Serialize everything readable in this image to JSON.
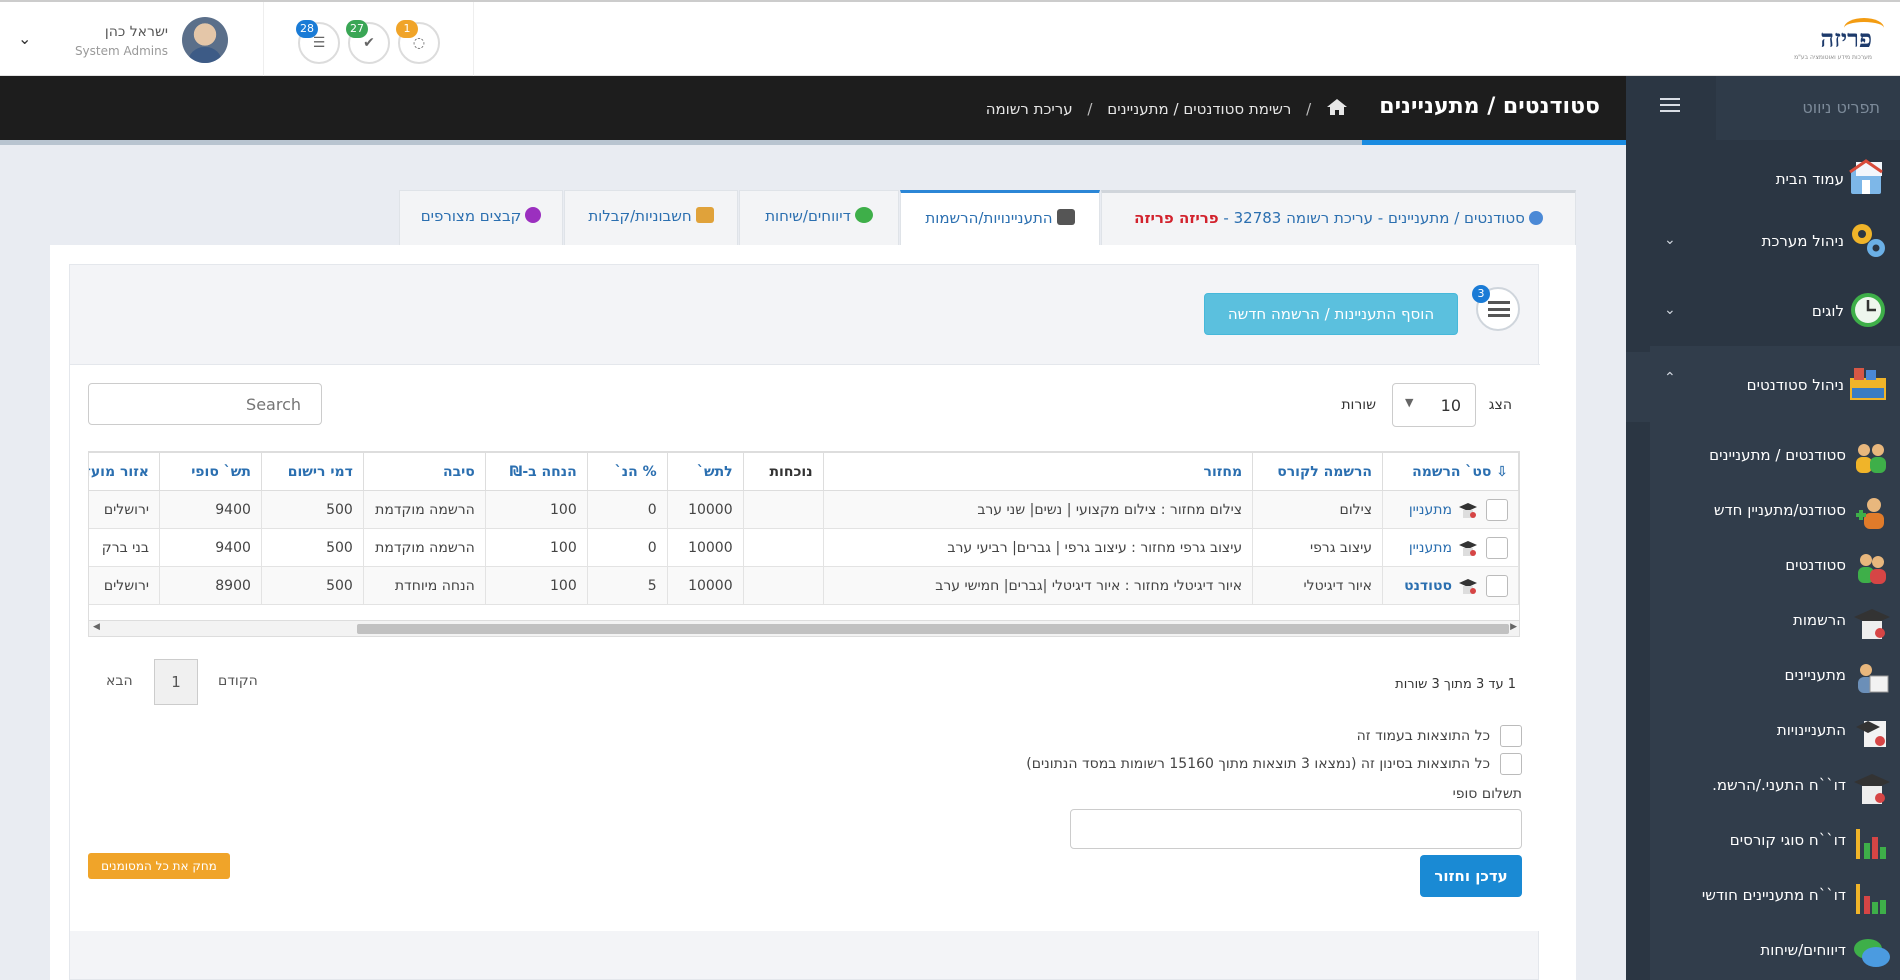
{
  "header": {
    "logo_text": "פריזה",
    "logo_tagline": "מערכות מידע ואוטומציה בע\"מ",
    "user": {
      "name": "ישראל כהן",
      "role": "System Admins"
    },
    "notifications": [
      {
        "count": "28",
        "icon": "tasks-icon",
        "color": "#1a7bd6"
      },
      {
        "count": "27",
        "icon": "check-icon",
        "color": "#3aa655"
      },
      {
        "count": "1",
        "icon": "spinner-icon",
        "color": "#f0a429"
      }
    ]
  },
  "sidebar": {
    "search_placeholder": "תפריט ניווט",
    "items": [
      {
        "label": "עמוד הבית",
        "icon": "home-page-icon"
      },
      {
        "label": "ניהול מערכת",
        "icon": "gears-icon"
      },
      {
        "label": "לוגים",
        "icon": "clock-icon"
      },
      {
        "label": "ניהול סטודנטים",
        "icon": "students-folder-icon"
      }
    ],
    "sub_items": [
      {
        "label": "סטודנטים / מתעניינים",
        "icon": "people-icon"
      },
      {
        "label": "סטודנט/מתעניין חדש",
        "icon": "add-person-icon"
      },
      {
        "label": "סטודנטים",
        "icon": "students-icon"
      },
      {
        "label": "הרשמות",
        "icon": "graduation-cap-icon"
      },
      {
        "label": "מתעניינים",
        "icon": "contact-card-icon"
      },
      {
        "label": "התעניינויות",
        "icon": "diploma-icon"
      },
      {
        "label": "דו``ח התעני./הרשמ.",
        "icon": "report-cap-icon"
      },
      {
        "label": "דו``ח סוגי קורסים",
        "icon": "bar-chart-icon"
      },
      {
        "label": "דו``ח מתעניינים חודשי",
        "icon": "bar-chart-people-icon"
      },
      {
        "label": "דיווחים/שיחות",
        "icon": "chat-icon"
      }
    ]
  },
  "pagebar": {
    "title": "סטודנטים / מתעניינים",
    "breadcrumbs": [
      "רשימת סטודנטים / מתעניינים",
      "עריכת רשומה"
    ]
  },
  "tabs": {
    "main_prefix": "סטודנטים / מתעניינים - עריכת רשומה 32783 - ",
    "main_name": "פריזה פריזה",
    "interests": "התעניינויות/הרשמות",
    "reports": "דיווחים/שיחות",
    "invoices": "חשבוניות/קבלות",
    "files": "קבצים מצורפים"
  },
  "toolbar": {
    "list_badge": "3",
    "add_button": "הוסף התעניינות / הרשמה חדשה"
  },
  "table": {
    "length_label": "הצג",
    "length_value": "10",
    "length_suffix": "שורות",
    "search_placeholder": "Search",
    "columns": [
      "סט` הרשמה",
      "הרשמה לקורס",
      "מחזור",
      "נוכחות",
      "לתש`",
      "% הנ`",
      "הנחה ב-₪",
      "סיבה",
      "דמי רישום",
      "תש` סופי",
      "אזור מועדן"
    ],
    "rows": [
      {
        "status": "מתעניין",
        "course": "צילום",
        "cycle": "צילום מחזור : צילום מקצועי | נשים| שני ערב",
        "attendance": "",
        "to_pay": "10000",
        "pct": "0",
        "discount": "100",
        "reason": "הרשמה מוקדמת",
        "reg_fee": "500",
        "final": "9400",
        "area": "ירושלים"
      },
      {
        "status": "מתעניין",
        "course": "עיצוב גרפי",
        "cycle": "עיצוב גרפי מחזור : עיצוב גרפי | גברים| רביעי ערב",
        "attendance": "",
        "to_pay": "10000",
        "pct": "0",
        "discount": "100",
        "reason": "הרשמה מוקדמת",
        "reg_fee": "500",
        "final": "9400",
        "area": "בני ברק"
      },
      {
        "status": "סטודנט",
        "course": "איור דיגיטלי",
        "cycle": "איור דיגיטלי מחזור : איור דיגיטלי |גברים| חמישי ערב",
        "attendance": "",
        "to_pay": "10000",
        "pct": "5",
        "discount": "100",
        "reason": "הנחה מיוחדת",
        "reg_fee": "500",
        "final": "8900",
        "area": "ירושלים"
      }
    ],
    "info": "1 עד 3 מתוך 3 שורות",
    "pager": {
      "prev": "הקודם",
      "page": "1",
      "next": "הבא"
    }
  },
  "form": {
    "select_page": "כל התוצאות בעמוד זה",
    "select_filter": "כל התוצאות בסינון זה (נמצאו 3 תוצאות מתוך 15160 רשומות במסד הנתונים)",
    "final_payment_label": "תשלום סופי",
    "save_button": "עדכן וחזור",
    "delete_button": "מחק את כל המסומנים"
  }
}
